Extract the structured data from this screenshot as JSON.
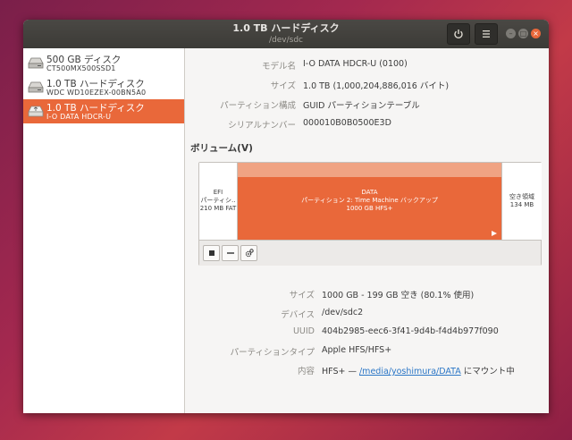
{
  "window": {
    "title": "1.0 TB ハードディスク",
    "subtitle": "/dev/sdc",
    "power_icon": "power-icon",
    "menu_icon": "hamburger-menu-icon"
  },
  "sidebar": {
    "drives": [
      {
        "name": "500 GB ディスク",
        "model": "CT500MX500SSD1",
        "icon": "ssd-drive-icon",
        "selected": false
      },
      {
        "name": "1.0 TB ハードディスク",
        "model": "WDC WD10EZEX-00BN5A0",
        "icon": "hard-disk-icon",
        "selected": false
      },
      {
        "name": "1.0 TB ハードディスク",
        "model": "I-O DATA HDCR-U",
        "icon": "usb-hard-disk-icon",
        "selected": true
      }
    ]
  },
  "disk_info": {
    "model_label": "モデル名",
    "model_value": "I-O DATA HDCR-U (0100)",
    "size_label": "サイズ",
    "size_value": "1.0 TB (1,000,204,886,016 バイト)",
    "partitioning_label": "パーティション構成",
    "partitioning_value": "GUID パーティションテーブル",
    "serial_label": "シリアルナンバー",
    "serial_value": "000010B0B0500E3D"
  },
  "volumes": {
    "heading": "ボリューム(V)",
    "efi": {
      "line1": "EFI",
      "line2": "パーティシ‥",
      "line3": "210 MB FAT"
    },
    "data": {
      "line1": "DATA",
      "line2": "パーティション 2: Time Machine バックアップ",
      "line3": "1000 GB HFS+"
    },
    "free": {
      "line1": "空き領域",
      "line2": "134 MB"
    },
    "toolbar": {
      "stop_icon": "stop-icon",
      "remove_icon": "minus-icon",
      "settings_icon": "gears-icon"
    }
  },
  "partition_info": {
    "size_label": "サイズ",
    "size_value": "1000 GB - 199 GB 空き (80.1% 使用)",
    "device_label": "デバイス",
    "device_value": "/dev/sdc2",
    "uuid_label": "UUID",
    "uuid_value": "404b2985-eec6-3f41-9d4b-f4d4b977f090",
    "type_label": "パーティションタイプ",
    "type_value": "Apple HFS/HFS+",
    "contents_label": "内容",
    "contents_prefix": "HFS+ — ",
    "contents_link": "/media/yoshimura/DATA",
    "contents_suffix": " にマウント中"
  },
  "colors": {
    "accent": "#e9683a",
    "titlebar": "#3c3b37",
    "window_bg": "#f6f5f4"
  }
}
